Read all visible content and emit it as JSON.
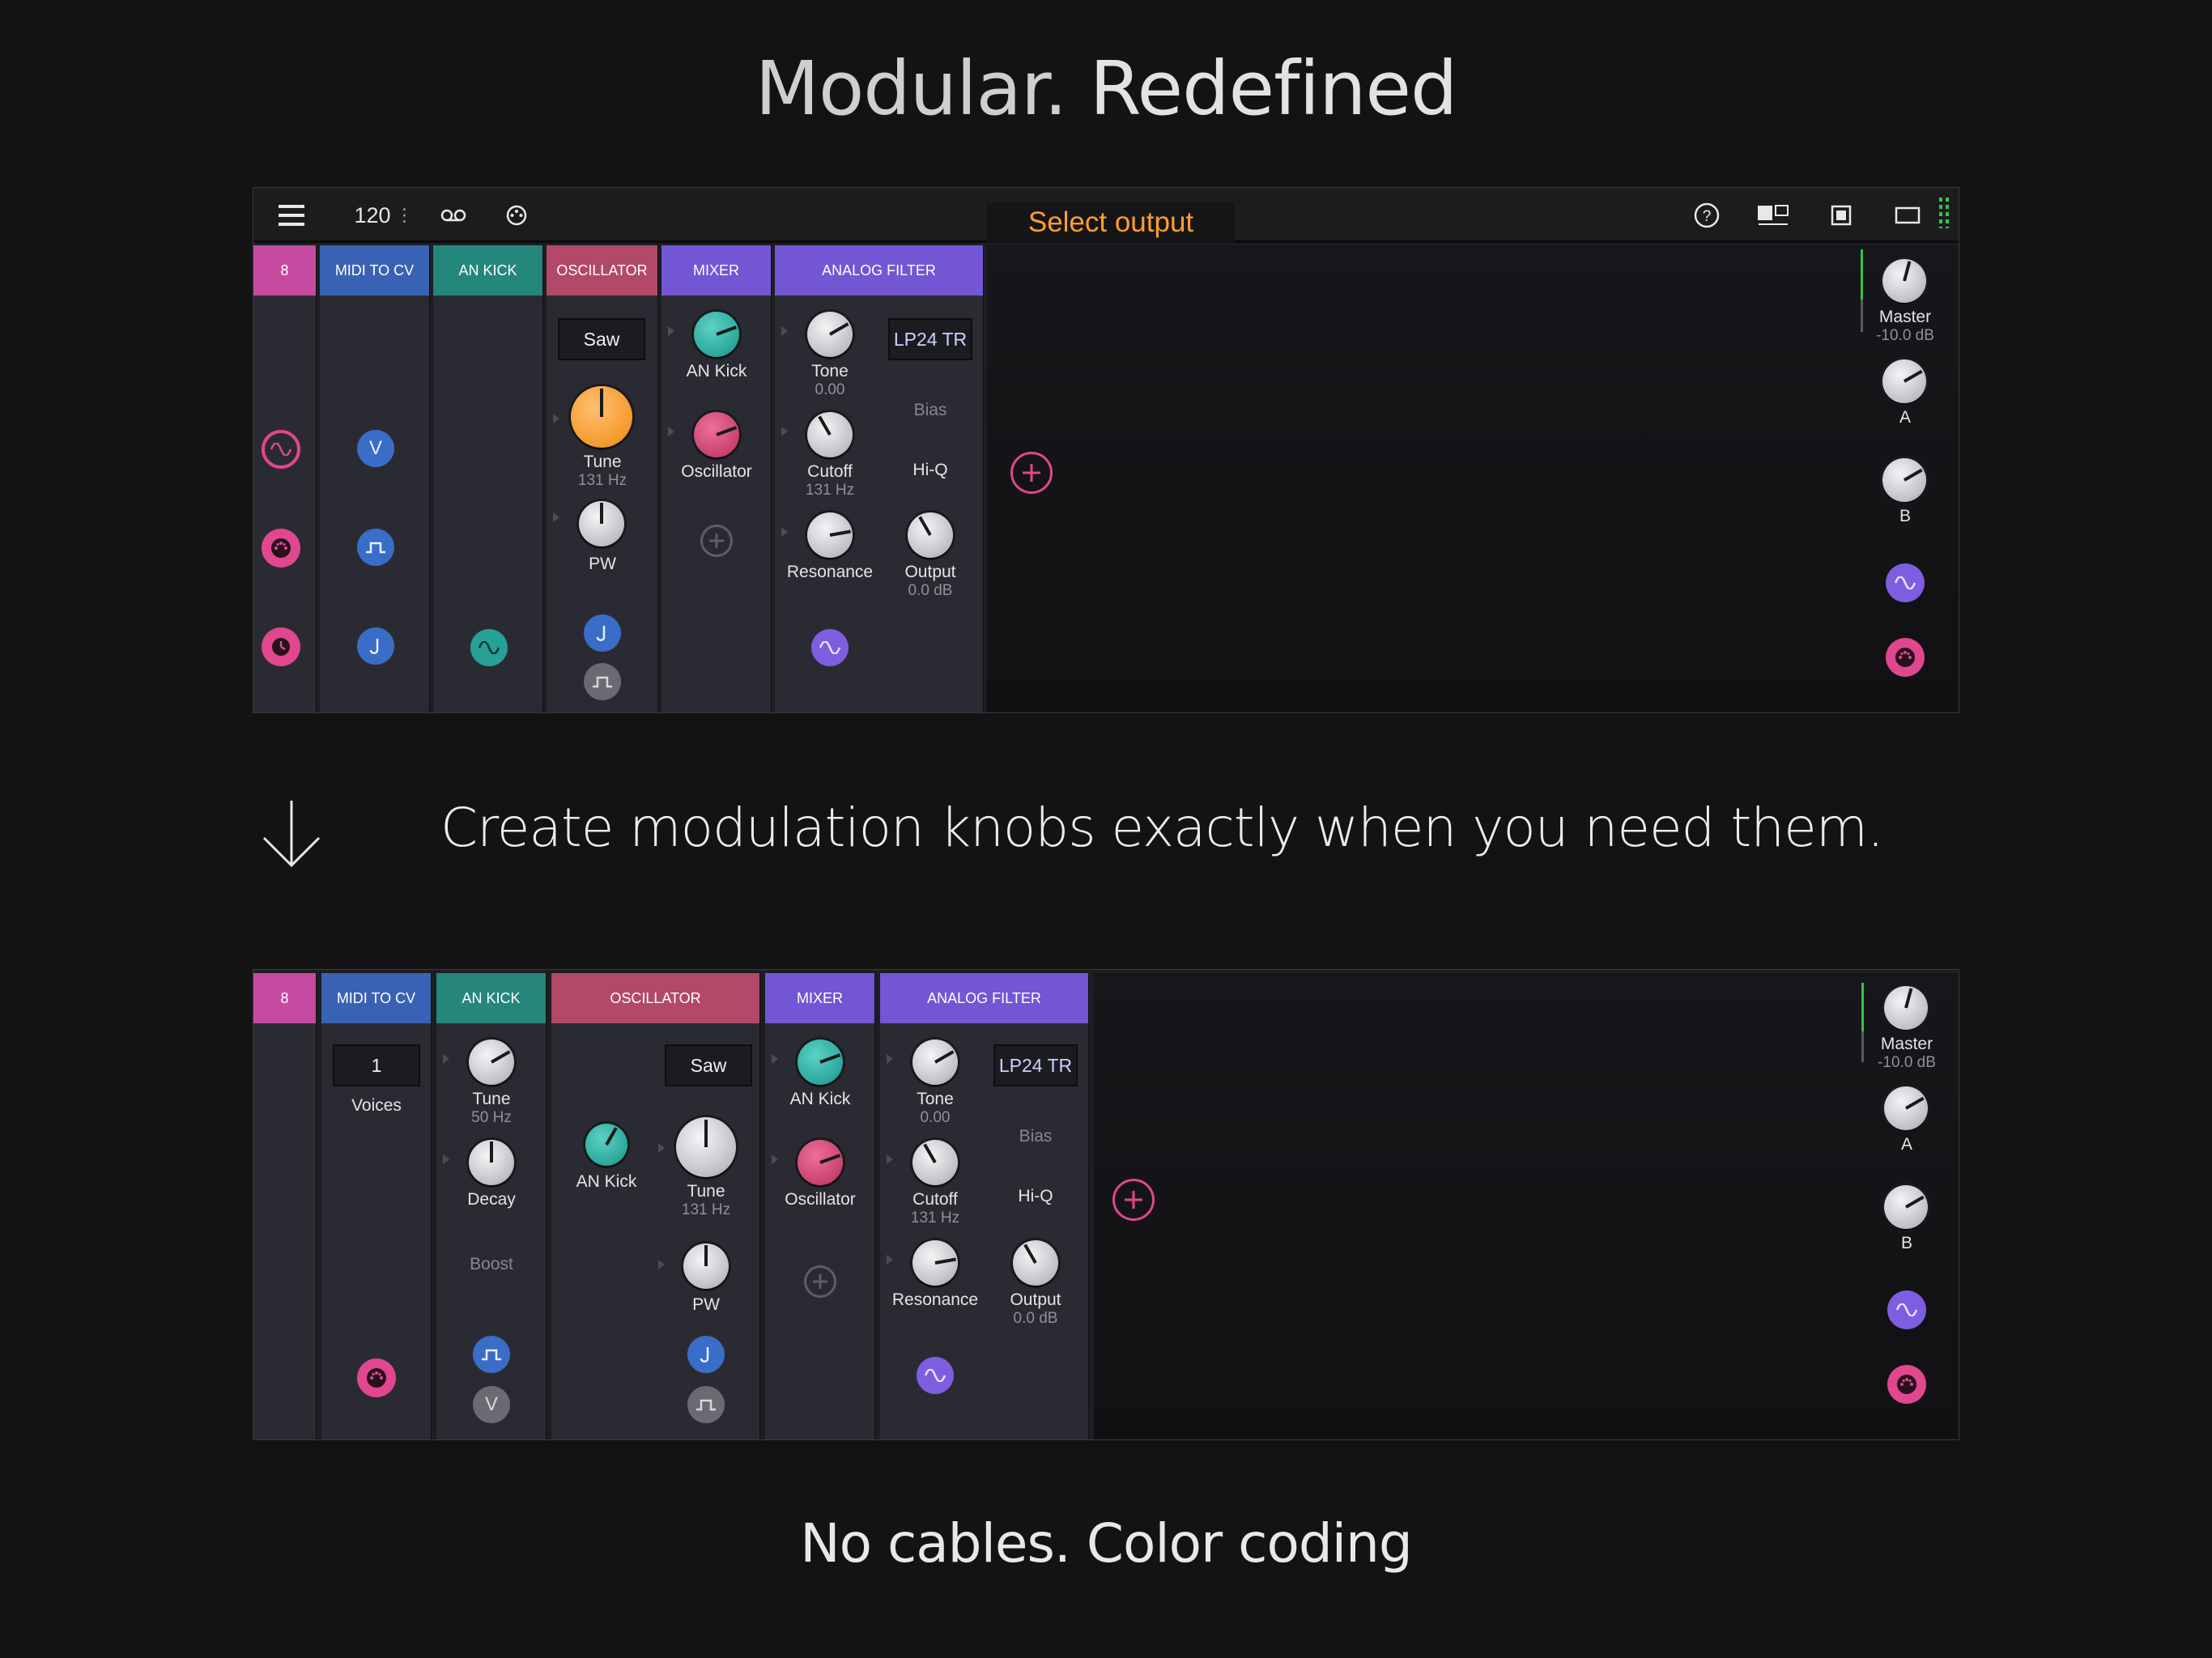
{
  "headline": {
    "part1": "Modular.",
    "part2": "Redefined"
  },
  "tagline": "Create modulation knobs exactly when you need them.",
  "footer": "No cables. Color coding",
  "toolbar": {
    "tempo": "120",
    "tempo_dots": "⋮",
    "select_output": "Select output"
  },
  "panel1": {
    "modules": {
      "channel": "8",
      "midi": "MIDI TO CV",
      "ankick": "AN KICK",
      "osc": "OSCILLATOR",
      "mixer": "MIXER",
      "filter": "ANALOG FILTER"
    },
    "osc": {
      "wave": "Saw",
      "tune": "Tune",
      "tune_val": "131 Hz",
      "pw": "PW"
    },
    "mixer": {
      "a": "AN Kick",
      "b": "Oscillator"
    },
    "filter": {
      "tone": "Tone",
      "tone_val": "0.00",
      "mode": "LP24 TR",
      "bias": "Bias",
      "cutoff": "Cutoff",
      "cutoff_val": "131 Hz",
      "hiq": "Hi-Q",
      "res": "Resonance",
      "output": "Output",
      "output_val": "0.0 dB"
    },
    "master": {
      "label": "Master",
      "value": "-10.0 dB",
      "a": "A",
      "b": "B"
    }
  },
  "panel2": {
    "modules": {
      "channel": "8",
      "midi": "MIDI TO CV",
      "ankick": "AN KICK",
      "osc": "OSCILLATOR",
      "mixer": "MIXER",
      "filter": "ANALOG FILTER"
    },
    "midi": {
      "voices_val": "1",
      "voices": "Voices"
    },
    "ankick": {
      "tune": "Tune",
      "tune_val": "50 Hz",
      "decay": "Decay",
      "boost": "Boost"
    },
    "osc": {
      "mod": "AN Kick",
      "wave": "Saw",
      "tune": "Tune",
      "tune_val": "131 Hz",
      "pw": "PW"
    },
    "mixer": {
      "a": "AN Kick",
      "b": "Oscillator"
    },
    "filter": {
      "tone": "Tone",
      "tone_val": "0.00",
      "mode": "LP24 TR",
      "bias": "Bias",
      "cutoff": "Cutoff",
      "cutoff_val": "131 Hz",
      "hiq": "Hi-Q",
      "res": "Resonance",
      "output": "Output",
      "output_val": "0.0 dB"
    },
    "master": {
      "label": "Master",
      "value": "-10.0 dB",
      "a": "A",
      "b": "B"
    }
  },
  "colors": {
    "pink": "#e0478e",
    "blue": "#3a6dc7",
    "teal": "#27a096",
    "osc": "#b24968",
    "purple": "#7d5ee0",
    "orange": "#ff9d2e",
    "meter": "#3bc24a"
  }
}
